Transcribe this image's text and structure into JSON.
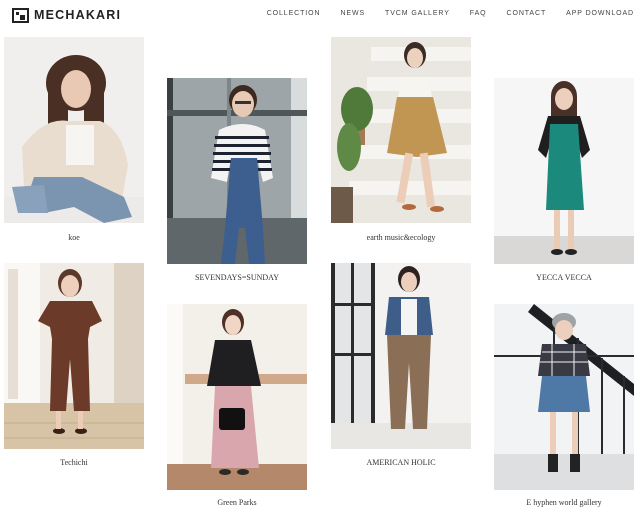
{
  "brand": {
    "logo_text": "MECHAKARI"
  },
  "nav": {
    "items": [
      {
        "label": "COLLECTION"
      },
      {
        "label": "NEWS"
      },
      {
        "label": "TVCM GALLERY"
      },
      {
        "label": "FAQ"
      },
      {
        "label": "CONTACT"
      },
      {
        "label": "APP DOWNLOAD"
      }
    ]
  },
  "brands": [
    {
      "name": "koe"
    },
    {
      "name": "SEVENDAYS=SUNDAY"
    },
    {
      "name": "earth music&ecology"
    },
    {
      "name": "YECCA VECCA"
    },
    {
      "name": "Techichi"
    },
    {
      "name": "Green Parks"
    },
    {
      "name": "AMERICAN HOLIC"
    },
    {
      "name": "E hyphen world gallery"
    }
  ]
}
